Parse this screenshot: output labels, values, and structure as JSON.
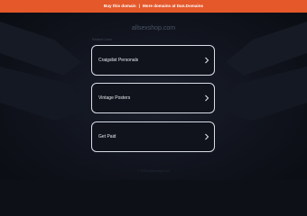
{
  "banner": {
    "link_buy": "Buy this domain",
    "separator": "|",
    "link_more": "More domains at Dan.Domains",
    "color": "#e4582a"
  },
  "domain_title": "allsexshop.com",
  "related_label": "Related Links",
  "links": [
    {
      "label": "Craigslist Personals",
      "icon": "chevron-right-icon"
    },
    {
      "label": "Vintage Posters",
      "icon": "chevron-right-icon"
    },
    {
      "label": "Get Paid",
      "icon": "chevron-right-icon"
    }
  ],
  "footer": "© 2025 allsexshop.com"
}
